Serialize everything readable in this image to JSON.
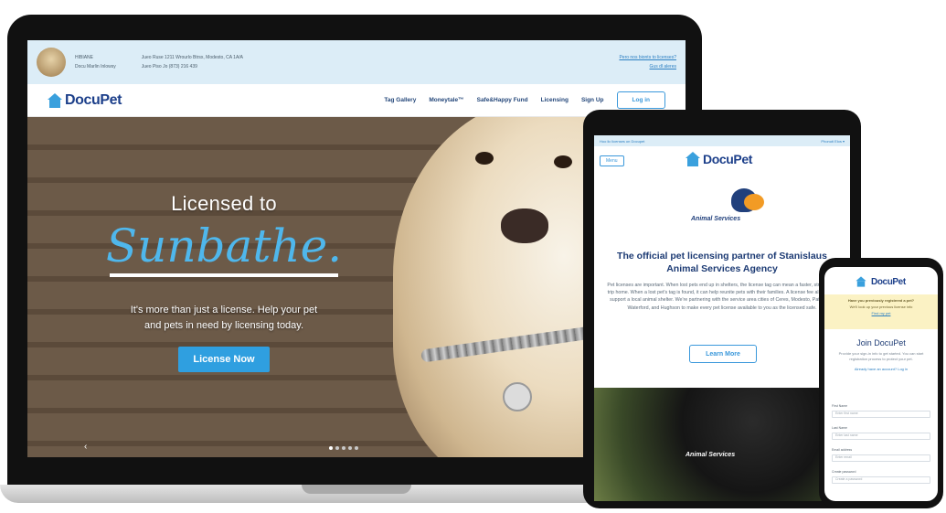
{
  "laptop": {
    "topbar": {
      "col1": [
        "HIBIANE",
        "Docu  Marlin Inlowsy"
      ],
      "col2": [
        "Jueo Ruse 1211 Wrourlo Btrsx, Modesto, CA 1A/A",
        "Jueo Piso Jo (873) 216 439"
      ],
      "links": [
        "Pero nos bionts to licenses?",
        "Gus dl aleres"
      ]
    },
    "nav": {
      "logo": "DocuPet",
      "links": [
        "Tag Gallery",
        "Moneytale™",
        "Safe&Happy Fund",
        "Licensing",
        "Sign Up"
      ],
      "login": "Log in"
    },
    "hero": {
      "title": "Licensed to",
      "script": "Sunbathe.",
      "body_line1": "It's more than just a license. Help your pet",
      "body_line2": "and pets in need by licensing today.",
      "cta": "License Now",
      "arrow": "‹"
    }
  },
  "tablet": {
    "top_left": "Hoo lic licenses on Docupet",
    "top_right": "Phonuti Elos ▾",
    "back": "Menu",
    "logo": "DocuPet",
    "agency_name": "Animal Services",
    "heading": "The official pet licensing partner of Stanislaus Animal Services Agency",
    "body": "Pet licenses are important. When lost pets end up in shelters, the license tag can mean a faster, stress-free trip home. When a lost pet's tag is found, it can help reunite pets with their families. A license fee also helps support a local animal shelter. We're partnering with the service area cities of Ceres, Modesto, Patterson, Waterford, and Hughson to make every pet license available to you as the licensed safe.",
    "learn_more": "Learn More",
    "photo_label": "Animal Services"
  },
  "phone": {
    "logo": "DocuPet",
    "alert_line1": "Have you previously registered a pet?",
    "alert_line2": "We'll look up your previous license info",
    "alert_link": "Find my pet",
    "join": "Join DocuPet",
    "sub": "Provide your sign-in info to get started. You can start registration process to protect your pet.",
    "signin": "Already have an account? Log in",
    "labels": [
      "First Name",
      "Last Name",
      "Email address",
      "Create password"
    ],
    "placeholders": [
      "Enter first name",
      "Enter last name",
      "Enter email",
      "Create a password"
    ]
  }
}
